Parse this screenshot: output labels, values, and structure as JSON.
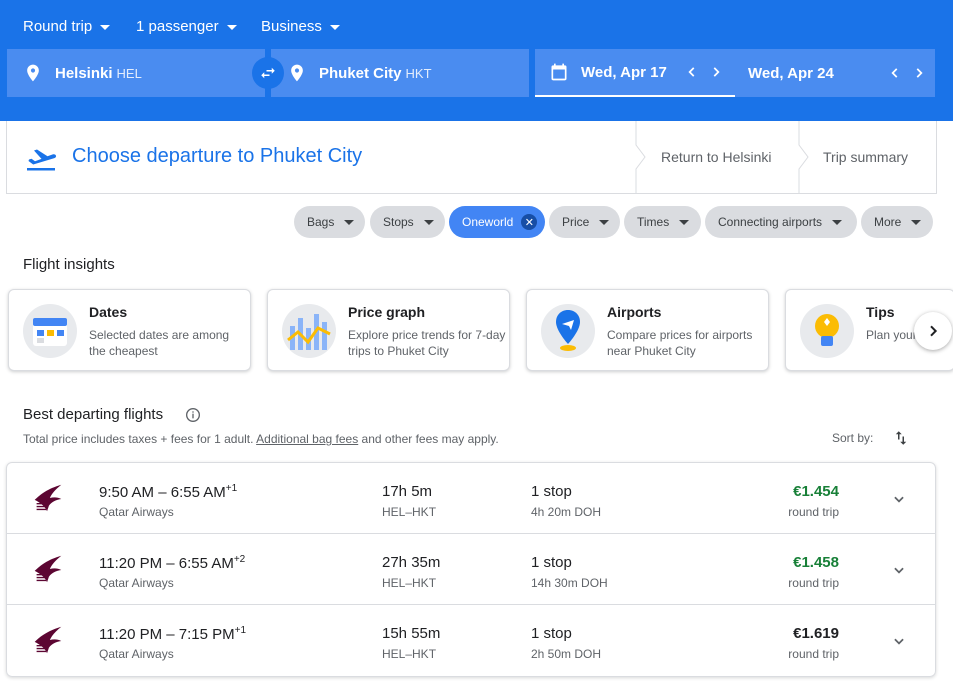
{
  "colors": {
    "brand_blue": "#1a73e8",
    "price_green": "#188038",
    "price_default": "#202124"
  },
  "header": {
    "trip_type": "Round trip",
    "passengers": "1 passenger",
    "cabin": "Business",
    "origin": {
      "city": "Helsinki",
      "code": "HEL"
    },
    "destination": {
      "city": "Phuket City",
      "code": "HKT"
    },
    "depart_date": "Wed, Apr 17",
    "return_date": "Wed, Apr 24"
  },
  "steps": {
    "current": "Choose departure to Phuket City",
    "next": "Return to Helsinki",
    "last": "Trip summary"
  },
  "filters": [
    {
      "label": "Bags",
      "active": false
    },
    {
      "label": "Stops",
      "active": false
    },
    {
      "label": "Oneworld",
      "active": true
    },
    {
      "label": "Price",
      "active": false
    },
    {
      "label": "Times",
      "active": false
    },
    {
      "label": "Connecting airports",
      "active": false
    },
    {
      "label": "More",
      "active": false
    }
  ],
  "insights": {
    "heading": "Flight insights",
    "cards": [
      {
        "title": "Dates",
        "desc": "Selected dates are among the cheapest",
        "icon": "calendar-icon"
      },
      {
        "title": "Price graph",
        "desc": "Explore price trends for 7-day trips to Phuket City",
        "icon": "price-graph-icon"
      },
      {
        "title": "Airports",
        "desc": "Compare prices for airports near Phuket City",
        "icon": "airport-pin-icon"
      },
      {
        "title": "Tips",
        "desc": "Plan your trip to Phuket City",
        "icon": "lightbulb-icon"
      }
    ]
  },
  "results": {
    "heading": "Best departing flights",
    "subtext_prefix": "Total price includes taxes + fees for 1 adult. ",
    "subtext_link": "Additional bag fees",
    "subtext_suffix": " and other fees may apply.",
    "sort_label": "Sort by:",
    "flights": [
      {
        "depart": "9:50 AM",
        "arrive": "6:55 AM",
        "day_offset": "+1",
        "airline": "Qatar Airways",
        "duration": "17h 5m",
        "route": "HEL–HKT",
        "stops": "1 stop",
        "layover": "4h 20m DOH",
        "price": "€1.454",
        "price_type": "round trip",
        "highlight": true
      },
      {
        "depart": "11:20 PM",
        "arrive": "6:55 AM",
        "day_offset": "+2",
        "airline": "Qatar Airways",
        "duration": "27h 35m",
        "route": "HEL–HKT",
        "stops": "1 stop",
        "layover": "14h 30m DOH",
        "price": "€1.458",
        "price_type": "round trip",
        "highlight": true
      },
      {
        "depart": "11:20 PM",
        "arrive": "7:15 PM",
        "day_offset": "+1",
        "airline": "Qatar Airways",
        "duration": "15h 55m",
        "route": "HEL–HKT",
        "stops": "1 stop",
        "layover": "2h 50m DOH",
        "price": "€1.619",
        "price_type": "round trip",
        "highlight": false
      }
    ]
  }
}
